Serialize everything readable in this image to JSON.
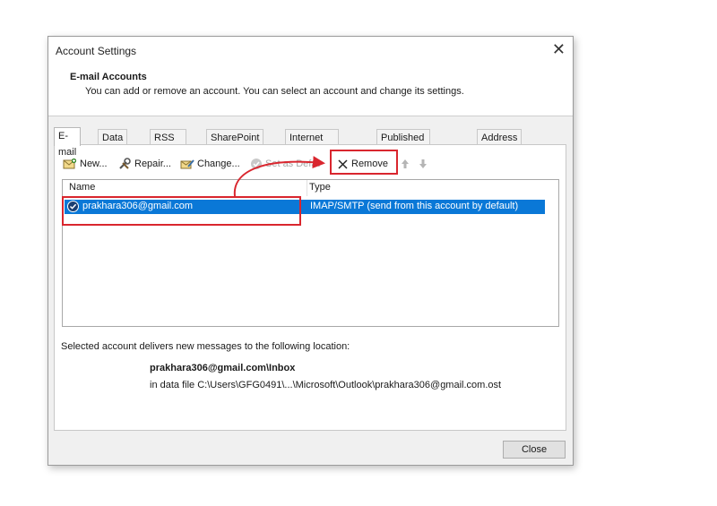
{
  "window": {
    "title": "Account Settings",
    "close_glyph": "✕"
  },
  "header": {
    "title": "E-mail Accounts",
    "description": "You can add or remove an account. You can select an account and change its settings."
  },
  "tabs": [
    {
      "label": "E-mail",
      "active": true
    },
    {
      "label": "Data Files"
    },
    {
      "label": "RSS Feeds"
    },
    {
      "label": "SharePoint Lists"
    },
    {
      "label": "Internet Calendars"
    },
    {
      "label": "Published Calendars"
    },
    {
      "label": "Address Books"
    }
  ],
  "toolbar": {
    "new_label": "New...",
    "repair_label": "Repair...",
    "change_label": "Change...",
    "set_default_label": "Set as Default",
    "remove_label": "Remove"
  },
  "accounts": {
    "col_name": "Name",
    "col_type": "Type",
    "rows": [
      {
        "name": "prakhara306@gmail.com",
        "type": "IMAP/SMTP (send from this account by default)"
      }
    ]
  },
  "delivery": {
    "label": "Selected account delivers new messages to the following location:",
    "folder": "prakhara306@gmail.com\\Inbox",
    "data_file": "in data file C:\\Users\\GFG0491\\...\\Microsoft\\Outlook\\prakhara306@gmail.com.ost"
  },
  "footer": {
    "close_label": "Close"
  },
  "colors": {
    "selection": "#0a78d7",
    "highlight_annotation": "#d9262e"
  }
}
